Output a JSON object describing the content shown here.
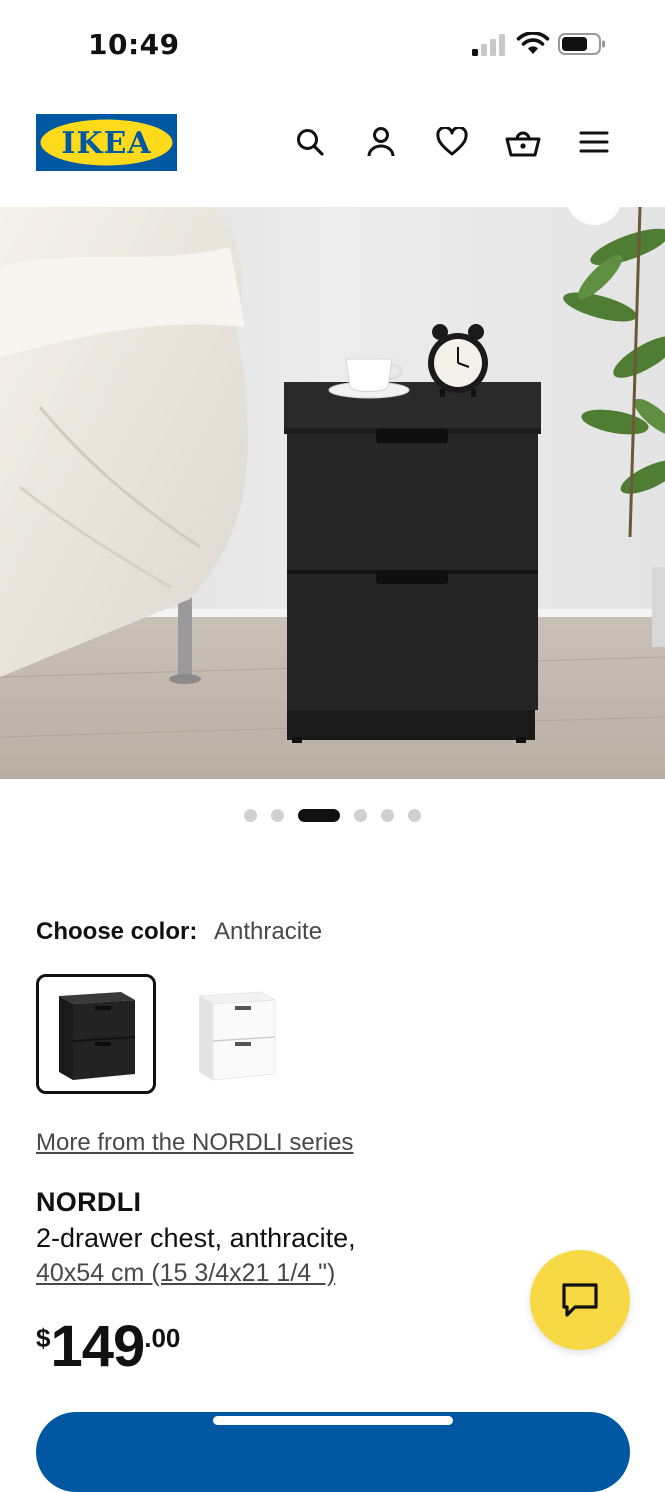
{
  "status_bar": {
    "time": "10:49"
  },
  "header": {
    "logo_text": "IKEA",
    "icons": [
      "search-icon",
      "user-icon",
      "heart-icon",
      "basket-icon",
      "menu-icon"
    ]
  },
  "carousel": {
    "total": 6,
    "active_index": 2
  },
  "color_chooser": {
    "label": "Choose color:",
    "selected": "Anthracite",
    "options": [
      "Anthracite",
      "White"
    ]
  },
  "product": {
    "series_link": "More from the NORDLI series",
    "name": "NORDLI",
    "description": "2-drawer chest, anthracite,",
    "size": "40x54 cm (15 3/4x21 1/4 \")",
    "price": {
      "currency": "$",
      "integer": "149",
      "decimal": ".00"
    }
  },
  "colors": {
    "brand_blue": "#0058a3",
    "brand_yellow": "#ffda1a",
    "chat_fab": "#f7d946"
  }
}
